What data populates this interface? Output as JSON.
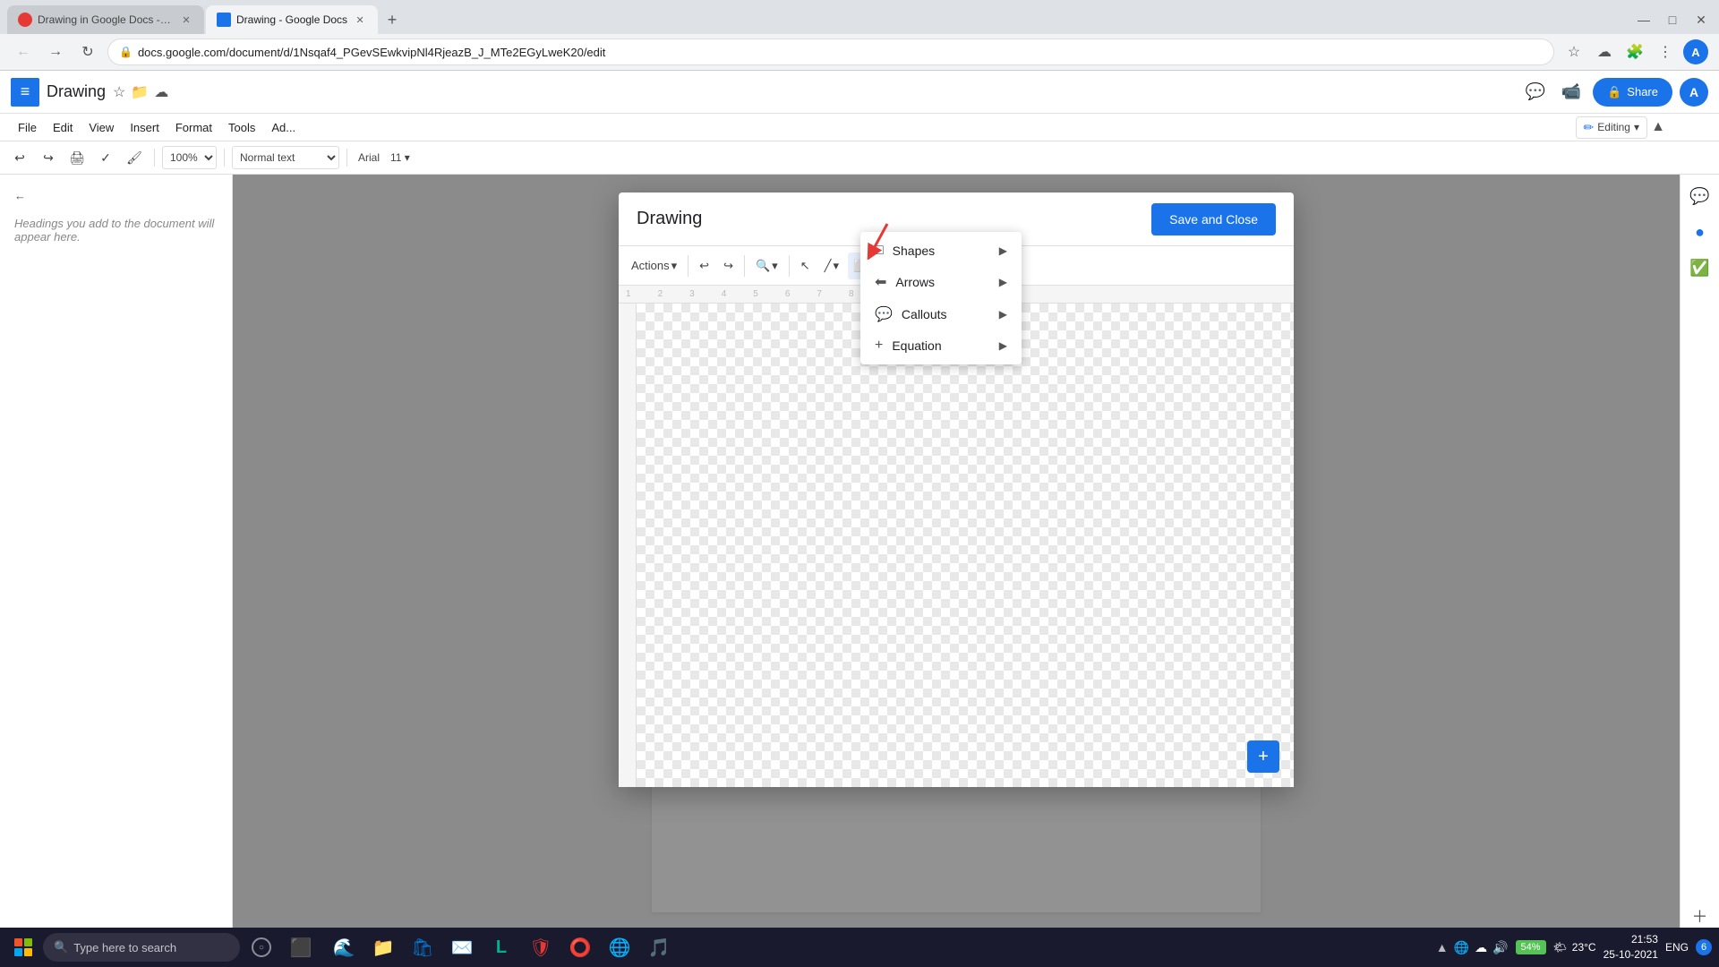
{
  "browser": {
    "tabs": [
      {
        "id": "tab1",
        "title": "Drawing in Google Docs - Goo",
        "favicon_type": "red",
        "active": false
      },
      {
        "id": "tab2",
        "title": "Drawing - Google Docs",
        "favicon_type": "blue",
        "active": true
      }
    ],
    "new_tab_label": "+",
    "url": "docs.google.com/document/d/1Nsqaf4_PGevSEwkvipNl4RjeazB_J_MTe2EGyLweK20/edit",
    "nav": {
      "back": "←",
      "forward": "→",
      "refresh": "↻"
    },
    "controls": {
      "minimize": "—",
      "maximize": "□",
      "close": "✕"
    }
  },
  "docs": {
    "logo_letter": "≡",
    "title": "Drawing",
    "menu_items": [
      "File",
      "Edit",
      "View",
      "Insert",
      "Format",
      "Tools",
      "Ad..."
    ],
    "header_icons": {
      "comment": "💬",
      "add": "＋",
      "share_label": "Share",
      "lock_icon": "🔒",
      "profile_letter": "A"
    },
    "toolbar": {
      "undo": "↩",
      "redo": "↪",
      "print": "🖨",
      "spell": "✓",
      "paint": "🖌",
      "zoom": "100%",
      "zoom_arrow": "▾",
      "style": "Normal text",
      "style_arrow": "▾"
    },
    "editing_badge": "Editing",
    "sidebar": {
      "back_label": "←",
      "heading": "Headings you add to the document will appear here."
    }
  },
  "drawing_dialog": {
    "title": "Drawing",
    "save_close_btn": "Save and Close",
    "toolbar": {
      "actions_label": "Actions",
      "actions_arrow": "▾",
      "undo": "↩",
      "redo": "↪",
      "zoom_label": "🔍",
      "zoom_arrow": "▾",
      "select_icon": "↖",
      "line_icon": "╱",
      "line_arrow": "▾",
      "shapes_icon": "⬜",
      "shapes_active": true,
      "text_icon": "T",
      "image_icon": "🖼"
    },
    "shapes_menu": {
      "items": [
        {
          "id": "shapes",
          "icon": "□",
          "label": "Shapes",
          "has_arrow": true
        },
        {
          "id": "arrows",
          "icon": "⬅",
          "label": "Arrows",
          "has_arrow": true
        },
        {
          "id": "callouts",
          "icon": "💬",
          "label": "Callouts",
          "has_arrow": true
        },
        {
          "id": "equation",
          "icon": "+",
          "label": "Equation",
          "has_arrow": true
        }
      ]
    }
  },
  "right_panel": {
    "icons": [
      "💬",
      "🔵",
      "✅"
    ]
  },
  "taskbar": {
    "search_placeholder": "Type here to search",
    "weather": {
      "icon": "☀️",
      "temp": "23°C"
    },
    "clock": {
      "time": "21:53",
      "date": "25-10-2021"
    },
    "battery_label": "54%",
    "lang": "ENG",
    "notification_num": "6"
  }
}
